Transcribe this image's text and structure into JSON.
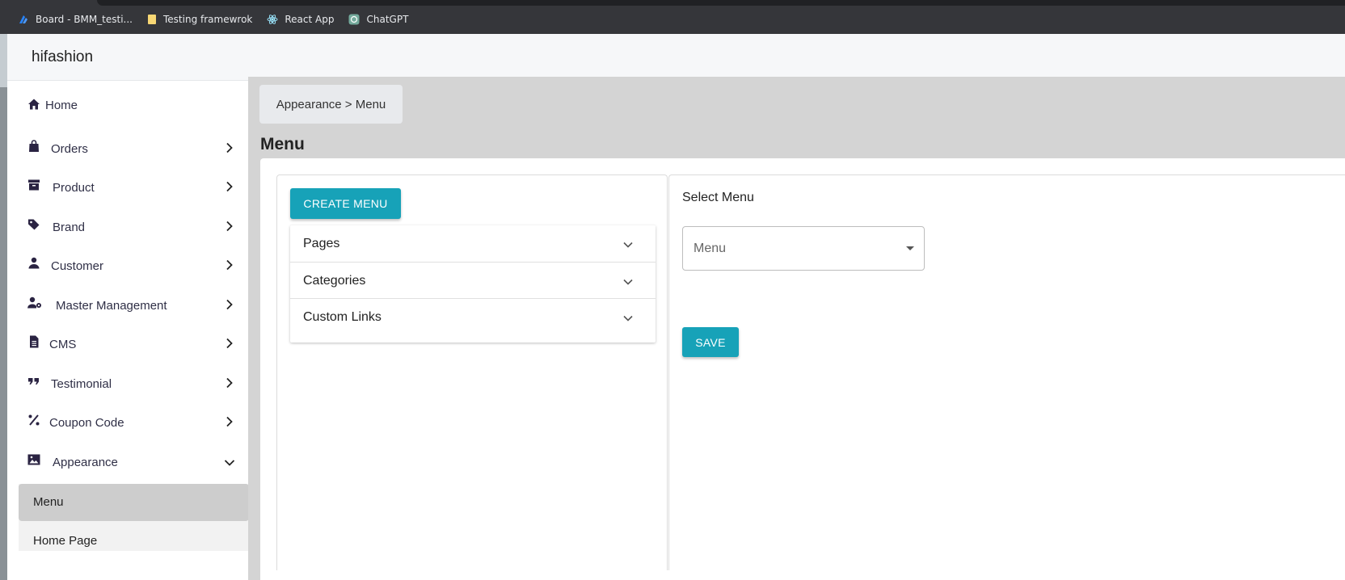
{
  "bookmarks": [
    {
      "label": "Board - BMM_testi...",
      "icon": "jira-icon"
    },
    {
      "label": "Testing framewrok",
      "icon": "folder-icon"
    },
    {
      "label": "React App",
      "icon": "react-icon"
    },
    {
      "label": "ChatGPT",
      "icon": "chatgpt-icon"
    }
  ],
  "app": {
    "brand": "hifashion"
  },
  "sidebar": {
    "items": [
      {
        "label": "Home",
        "icon": "home-icon"
      },
      {
        "label": "Orders",
        "icon": "bag-icon"
      },
      {
        "label": "Product",
        "icon": "archive-icon"
      },
      {
        "label": "Brand",
        "icon": "tag-icon"
      },
      {
        "label": "Customer",
        "icon": "person-icon"
      },
      {
        "label": "Master Management",
        "icon": "user-gear-icon"
      },
      {
        "label": "CMS",
        "icon": "document-icon"
      },
      {
        "label": "Testimonial",
        "icon": "quote-icon"
      },
      {
        "label": "Coupon Code",
        "icon": "percent-icon"
      },
      {
        "label": "Appearance",
        "icon": "image-icon"
      }
    ],
    "submenu": [
      {
        "label": "Menu",
        "active": true
      },
      {
        "label": "Home Page",
        "active": false
      }
    ]
  },
  "content": {
    "breadcrumb": "Appearance > Menu",
    "title": "Menu",
    "create_button": "CREATE MENU",
    "accordion": [
      {
        "label": "Pages"
      },
      {
        "label": "Categories"
      },
      {
        "label": "Custom Links"
      }
    ],
    "select_label": "Select Menu",
    "select_placeholder": "Menu",
    "save_button": "SAVE"
  },
  "colors": {
    "accent": "#17a2b8",
    "content_bg": "#d4d4d4",
    "sidebar_text": "#2f2f46",
    "active_sub_bg": "#cdcdcd",
    "browser_bar": "#35363a"
  }
}
